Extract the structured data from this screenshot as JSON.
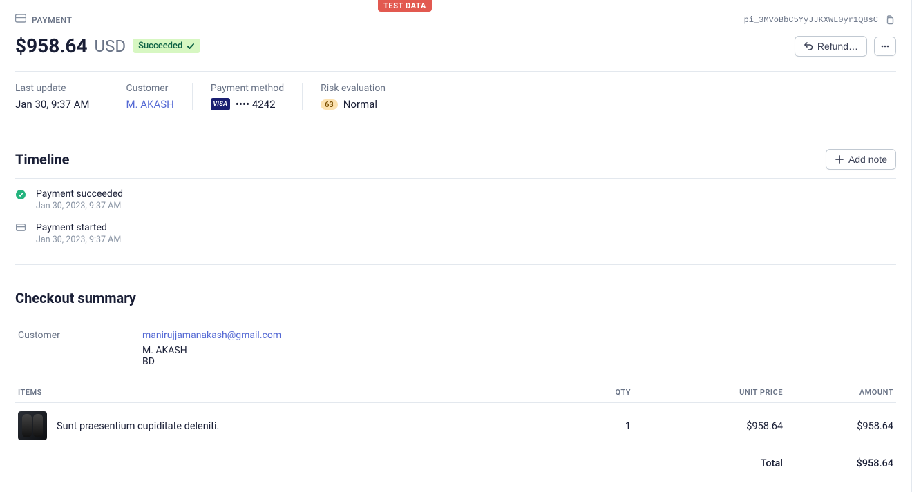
{
  "badge": {
    "test_data": "TEST DATA"
  },
  "header": {
    "breadcrumb": "PAYMENT",
    "payment_id": "pi_3MVoBbC5YyJJKXWL0yr1Q8sC"
  },
  "title": {
    "amount": "$958.64",
    "currency": "USD",
    "status": "Succeeded"
  },
  "actions": {
    "refund": "Refund…"
  },
  "meta": {
    "last_update_label": "Last update",
    "last_update_value": "Jan 30, 9:37 AM",
    "customer_label": "Customer",
    "customer_value": "M. AKASH",
    "payment_method_label": "Payment method",
    "card_brand": "VISA",
    "card_last4": "•••• 4242",
    "risk_label": "Risk evaluation",
    "risk_score": "63",
    "risk_level": "Normal"
  },
  "timeline": {
    "heading": "Timeline",
    "add_note": "Add note",
    "items": [
      {
        "title": "Payment succeeded",
        "date": "Jan 30, 2023, 9:37 AM",
        "type": "success"
      },
      {
        "title": "Payment started",
        "date": "Jan 30, 2023, 9:37 AM",
        "type": "start"
      }
    ]
  },
  "checkout": {
    "heading": "Checkout summary",
    "customer_label": "Customer",
    "customer_email": "manirujjamanakash@gmail.com",
    "customer_name": "M. AKASH",
    "customer_country": "BD",
    "columns": {
      "items": "ITEMS",
      "qty": "QTY",
      "unit_price": "UNIT PRICE",
      "amount": "AMOUNT"
    },
    "line_items": [
      {
        "name": "Sunt praesentium cupiditate deleniti.",
        "qty": "1",
        "unit_price": "$958.64",
        "amount": "$958.64"
      }
    ],
    "total_label": "Total",
    "total_value": "$958.64"
  }
}
